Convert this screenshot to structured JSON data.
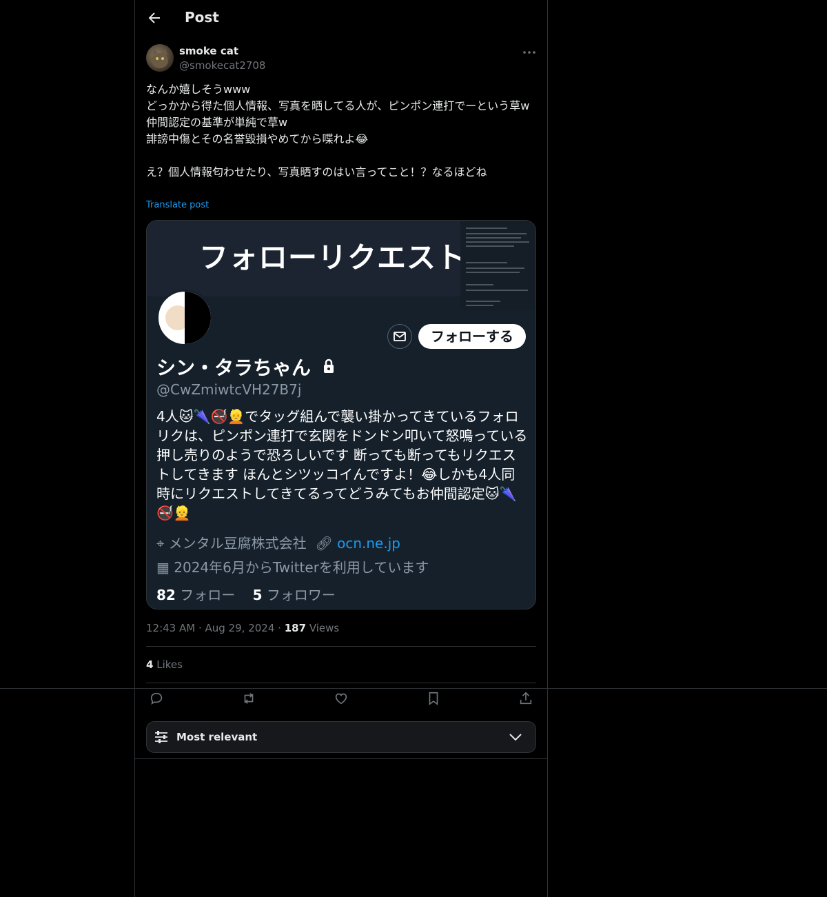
{
  "header": {
    "title": "Post"
  },
  "tweet": {
    "author_name": "smoke cat",
    "author_handle": "@smokecat2708",
    "lines": [
      "なんか嬉しそうwww",
      "どっかから得た個人情報、写真を晒してる人が、ピンポン連打でーという草w",
      "仲間認定の基準が単純で草w",
      "誹謗中傷とその名誉毀損やめてから喋れよ😂",
      "",
      "え？個人情報匂わせたり、写真晒すのはい言ってこと！？なるほどね"
    ],
    "translate_label": "Translate post",
    "time": "12:43 AM",
    "date": "Aug 29, 2024",
    "views_count": "187",
    "views_label": "Views",
    "likes_count": "4",
    "likes_label": "Likes"
  },
  "media": {
    "banner_title": "フォローリクエスト",
    "follow_label": "フォローする",
    "name": "シン・タラちゃん",
    "handle": "@CwZmiwtcVH27B7j",
    "bio": "4人🐱🌂🚭👱でタッグ組んで襲い掛かってきているフォロリクは、ピンポン連打で玄関をドンドン叩いて怒鳴っている押し売りのようで恐ろしいです 断っても断ってもリクエストしてきます ほんとシツッコイんですよ！😂しかも4人同時にリクエストしてきてるってどうみてもお仲間認定🐱🌂🚭👱",
    "location": "メンタル豆腐株式会社",
    "link": "ocn.ne.jp",
    "joined": "2024年6月からTwitterを利用しています",
    "following_count": "82",
    "following_label": "フォロー",
    "followers_count": "5",
    "followers_label": "フォロワー"
  },
  "sort": {
    "label": "Most relevant"
  },
  "icons": [
    "back-arrow-icon",
    "more-icon",
    "reply-icon",
    "retweet-icon",
    "like-icon",
    "bookmark-icon",
    "share-icon",
    "sliders-icon",
    "chevron-down-icon"
  ],
  "colors": {
    "accent": "#1d9bf0",
    "background": "#000000",
    "border": "#2f3336",
    "muted": "#71767b"
  }
}
